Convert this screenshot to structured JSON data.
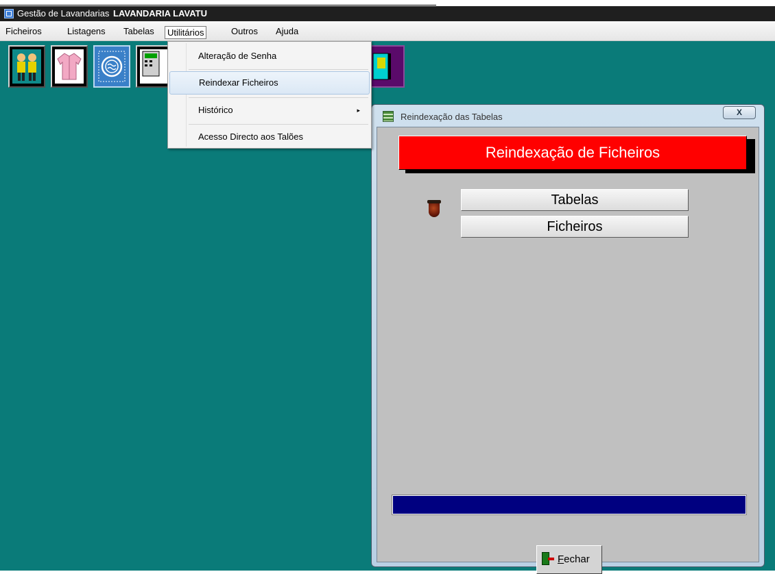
{
  "window": {
    "app_title": "Gestão de Lavandarias",
    "company": "LAVANDARIA LAVATU"
  },
  "menubar": {
    "items": [
      "Ficheiros",
      "Listagens",
      "Tabelas",
      "Utilitários",
      "Outros",
      "Ajuda"
    ],
    "active": "Utilitários"
  },
  "dropdown": {
    "items": [
      {
        "label": "Alteração de Senha"
      },
      {
        "label": "Reindexar Ficheiros",
        "highlighted": true
      },
      {
        "label": "Histórico",
        "submenu_arrow": "▸"
      },
      {
        "label": "Acesso Directo aos Talões"
      }
    ]
  },
  "toolbar": {
    "icons": [
      "people-icon",
      "shirt-icon",
      "washing-machine-icon",
      "calculator-icon",
      "exit-door-icon"
    ]
  },
  "dialog": {
    "title": "Reindexação das Tabelas",
    "close_label": "X",
    "banner": "Reindexação de Ficheiros",
    "btn_tabelas": "Tabelas",
    "btn_ficheiros": "Ficheiros",
    "btn_fechar": "Fechar",
    "progress": 0
  },
  "colors": {
    "desktop": "#0a7b79",
    "banner": "#ff0000",
    "progress_bar": "#000080"
  }
}
